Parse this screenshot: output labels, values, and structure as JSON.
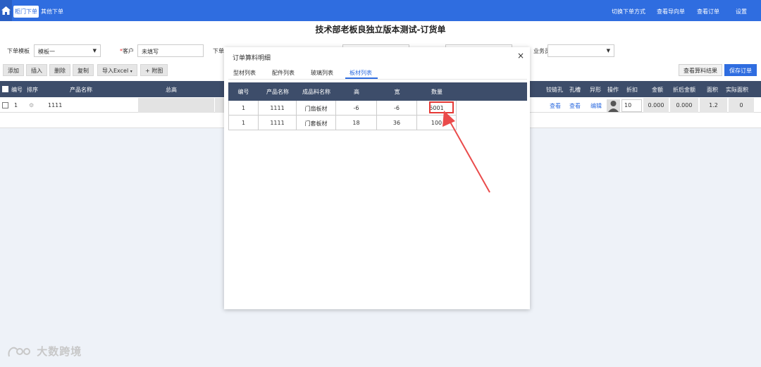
{
  "nav": {
    "tabs": [
      {
        "label": "柜门下单"
      },
      {
        "label": "其他下单"
      }
    ],
    "links": [
      {
        "label": "切换下单方式"
      },
      {
        "label": "查看导向单"
      },
      {
        "label": "查看订单"
      },
      {
        "label": "设置"
      }
    ]
  },
  "page": {
    "title": "技术部老板良独立版本测试-订货单"
  },
  "form": {
    "template_label": "下单模板",
    "template_value": "模板一",
    "customer_label": "客户",
    "customer_placeholder": "未填写",
    "order_label": "下单",
    "salesperson_label": "业务员"
  },
  "toolbar": {
    "add": "添加",
    "insert": "插入",
    "delete": "删除",
    "copy": "复制",
    "import_excel": "导入Excel",
    "attach_plus": "+",
    "attach": "附图",
    "view_calc": "查看算料结果",
    "save_order": "保存订单"
  },
  "table": {
    "headers": {
      "number": "编号",
      "sort": "排序",
      "product_name": "产品名称",
      "total": "总高",
      "hinge_hole": "铰链孔",
      "hole_slot": "孔槽",
      "special": "异形",
      "operation": "操作",
      "discount": "折扣",
      "amount": "金额",
      "discounted_amount": "折后金额",
      "area": "面积",
      "actual_area": "实际面积"
    },
    "row": {
      "number": "1",
      "product_name": "1111",
      "hinge_hole_link": "查看",
      "hole_slot_link": "查看",
      "special_link": "编辑",
      "discount": "10",
      "amount": "0.000",
      "discounted_amount": "0.000",
      "area": "1.2",
      "actual_area": "0"
    }
  },
  "modal": {
    "title": "订单算料明细",
    "close": "×",
    "tabs": [
      {
        "label": "型材列表"
      },
      {
        "label": "配件列表"
      },
      {
        "label": "玻璃列表"
      },
      {
        "label": "板材列表"
      }
    ],
    "active_tab": 3,
    "headers": [
      "编号",
      "产品名称",
      "成品料名称",
      "高",
      "宽",
      "数量"
    ],
    "rows": [
      [
        "1",
        "1111",
        "门扇板材",
        "-6",
        "-6",
        "5001"
      ],
      [
        "1",
        "1111",
        "门套板材",
        "18",
        "36",
        "100"
      ]
    ]
  },
  "watermark": {
    "text": "大数跨境"
  },
  "colors": {
    "primary": "#2f6de0",
    "table_header": "#3d4d6a",
    "highlight": "#e53935"
  }
}
